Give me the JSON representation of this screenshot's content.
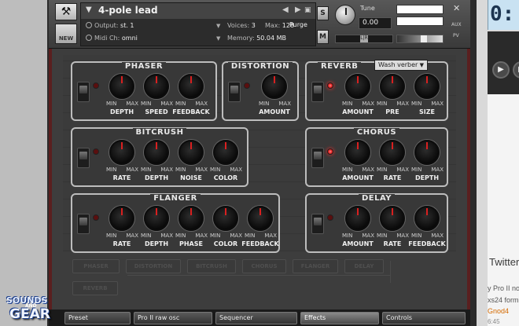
{
  "instrument": {
    "name": "4-pole lead",
    "output_label": "Output:",
    "output_value": "st. 1",
    "voices_label": "Voices:",
    "voices_value": "3",
    "max_label": "Max:",
    "max_value": "128",
    "purge_label": "Purge",
    "midi_label": "Midi Ch:",
    "midi_value": "omni",
    "memory_label": "Memory:",
    "memory_value": "50.04 MB",
    "new_label": "NEW",
    "solo_label": "S",
    "mute_label": "M",
    "tune_label": "Tune",
    "tune_value": "0.00",
    "pan_marker": "L|R",
    "aux_label": "AUX",
    "pv_label": "PV"
  },
  "effects": {
    "knob_min": "MIN",
    "knob_max": "MAX",
    "phaser": {
      "title": "PHASER",
      "enabled": false,
      "knobs": [
        "DEPTH",
        "SPEED",
        "FEEDBACK"
      ]
    },
    "distortion": {
      "title": "DISTORTION",
      "enabled": false,
      "knobs": [
        "AMOUNT"
      ]
    },
    "reverb": {
      "title": "REVERB",
      "enabled": true,
      "type": "Wash verber",
      "knobs": [
        "AMOUNT",
        "PRE",
        "SIZE"
      ]
    },
    "bitcrush": {
      "title": "BITCRUSH",
      "enabled": false,
      "knobs": [
        "RATE",
        "DEPTH",
        "NOISE",
        "COLOR"
      ]
    },
    "chorus": {
      "title": "CHORUS",
      "enabled": true,
      "knobs": [
        "AMOUNT",
        "RATE",
        "DEPTH"
      ]
    },
    "flanger": {
      "title": "FLANGER",
      "enabled": false,
      "knobs": [
        "RATE",
        "DEPTH",
        "PHASE",
        "COLOR",
        "FEEDBACK"
      ]
    },
    "delay": {
      "title": "DELAY",
      "enabled": false,
      "knobs": [
        "AMOUNT",
        "RATE",
        "FEEDBACK"
      ]
    }
  },
  "routing_chain": [
    "PHASER",
    "DISTORTION",
    "BITCRUSH",
    "CHORUS",
    "FLANGER",
    "DELAY",
    "REVERB"
  ],
  "tabs": [
    {
      "label": "Preset",
      "active": false
    },
    {
      "label": "Pro II raw osc",
      "active": false
    },
    {
      "label": "Sequencer",
      "active": false
    },
    {
      "label": "Effects",
      "active": true
    },
    {
      "label": "Controls",
      "active": false
    }
  ],
  "host_panel": {
    "lcd_digits": "0:",
    "twitter_label": "Twitter",
    "line1": "y Pro II no",
    "line2": "xs24 form",
    "line3": "Gnod4",
    "line4": "6:45"
  },
  "logo": {
    "top_text": "SOUNDS",
    "mid_text": "AND",
    "bottom_text": "GEAR"
  },
  "colors": {
    "led_on": "#e01818",
    "knob_pointer": "#d82020",
    "panel_border": "#bdbdbd"
  }
}
